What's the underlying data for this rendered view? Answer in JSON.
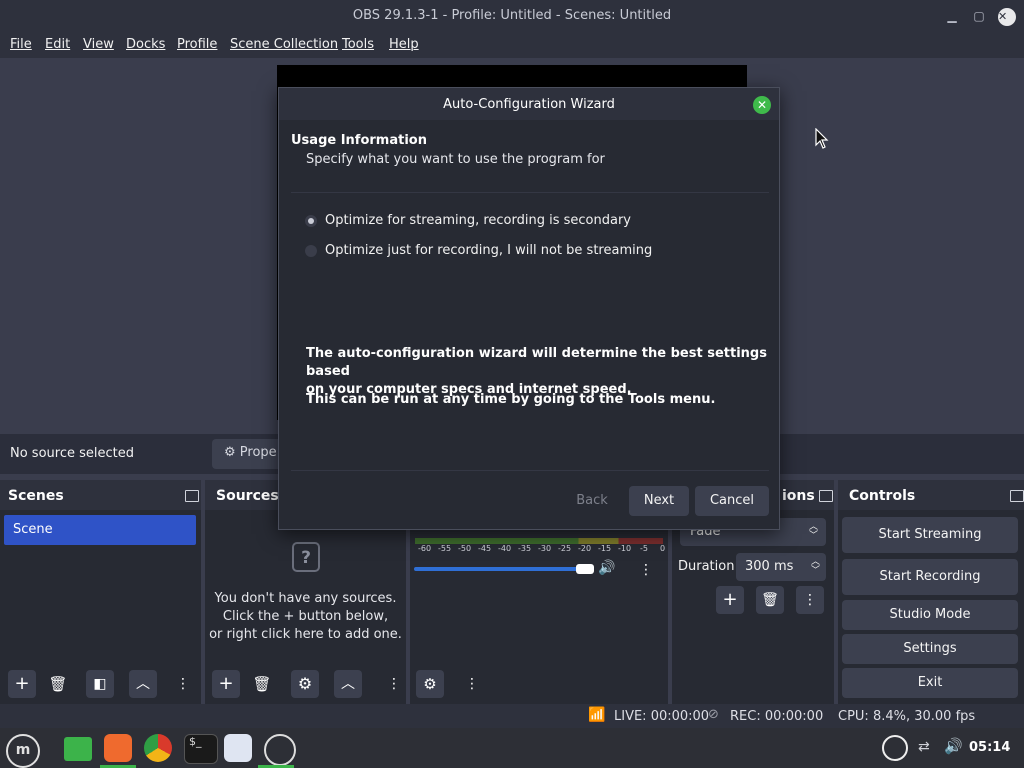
{
  "window": {
    "title": "OBS 29.1.3-1 - Profile: Untitled - Scenes: Untitled"
  },
  "menu": [
    "File",
    "Edit",
    "View",
    "Docks",
    "Profile",
    "Scene Collection",
    "Tools",
    "Help"
  ],
  "source_bar": {
    "no_source": "No source selected",
    "properties_label": "Prope"
  },
  "scenes": {
    "title": "Scenes",
    "items": [
      "Scene"
    ]
  },
  "sources": {
    "title": "Sources",
    "empty_line1": "You don't have any sources.",
    "empty_line2": "Click the + button below,",
    "empty_line3": "or right click here to add one."
  },
  "audio_mixer": {
    "ticks": [
      "-60",
      "-55",
      "-50",
      "-45",
      "-40",
      "-35",
      "-30",
      "-25",
      "-20",
      "-15",
      "-10",
      "-5",
      "0"
    ],
    "volume_fraction": 1.0
  },
  "transitions": {
    "title_partial": "ions",
    "transition_value": "Fade",
    "duration_label": "Duration",
    "duration_value": "300 ms"
  },
  "controls": {
    "title": "Controls",
    "buttons": [
      "Start Streaming",
      "Start Recording",
      "Studio Mode",
      "Settings",
      "Exit"
    ]
  },
  "status": {
    "live": "LIVE: 00:00:00",
    "rec": "REC: 00:00:00",
    "cpu": "CPU: 8.4%, 30.00 fps"
  },
  "taskbar": {
    "clock": "05:14",
    "apps": [
      "menu-icon",
      "files-icon",
      "firefox-icon",
      "chrome-icon",
      "terminal-icon",
      "apps-grid-icon",
      "obs-icon"
    ]
  },
  "dialog": {
    "title": "Auto-Configuration Wizard",
    "heading": "Usage Information",
    "subheading": "Specify what you want to use the program for",
    "options": [
      {
        "label": "Optimize for streaming, recording is secondary",
        "selected": true
      },
      {
        "label": "Optimize just for recording, I will not be streaming",
        "selected": false
      }
    ],
    "info1_line1": "The auto-configuration wizard will determine the best settings based",
    "info1_line2": "on your computer specs and internet speed.",
    "info2": "This can be run at any time by going to the Tools menu.",
    "back": "Back",
    "next": "Next",
    "cancel": "Cancel"
  }
}
